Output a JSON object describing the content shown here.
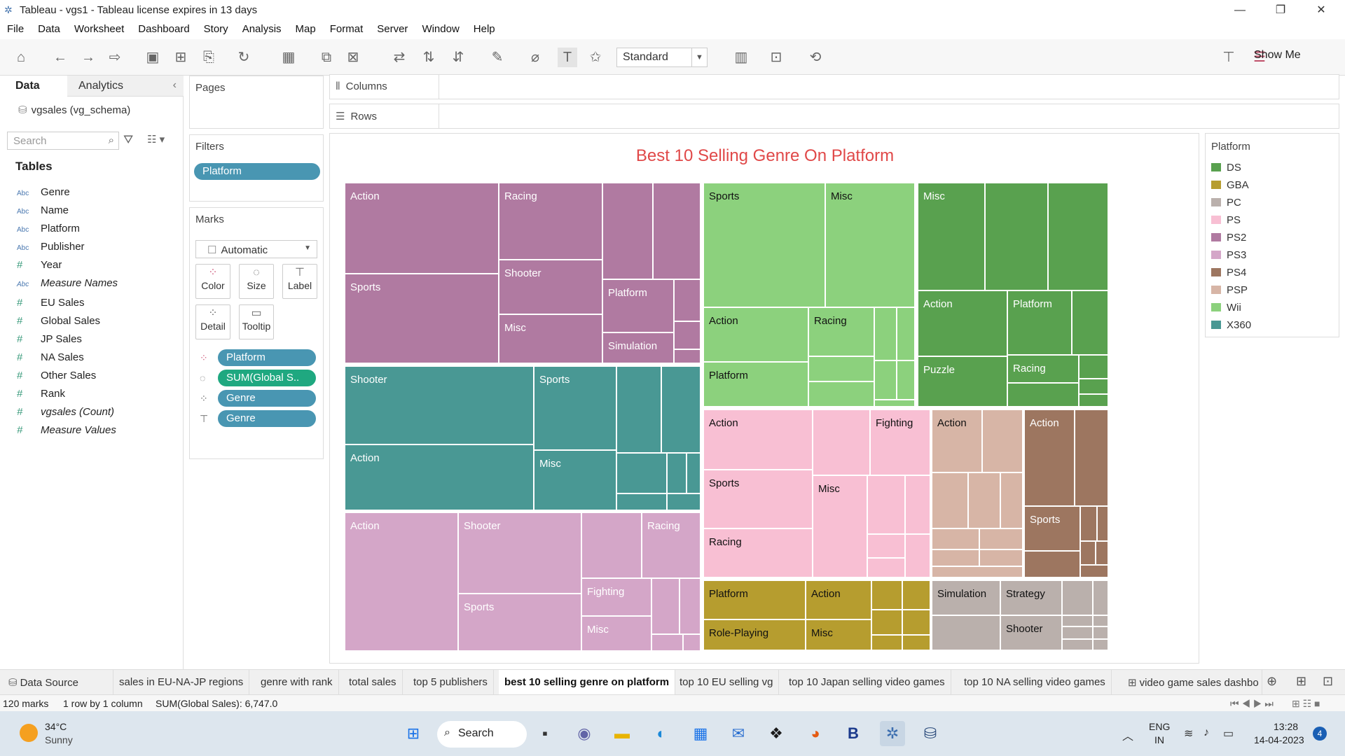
{
  "window": {
    "title": "Tableau - vgs1 - Tableau license expires in 13 days"
  },
  "menu": [
    "File",
    "Data",
    "Worksheet",
    "Dashboard",
    "Story",
    "Analysis",
    "Map",
    "Format",
    "Server",
    "Window",
    "Help"
  ],
  "toolbar": {
    "fit": "Standard",
    "show_me": "Show Me"
  },
  "data_pane": {
    "tab_data": "Data",
    "tab_analytics": "Analytics",
    "datasource": "vgsales (vg_schema)",
    "search_placeholder": "Search",
    "tables_heading": "Tables",
    "fields": [
      {
        "type": "Abc",
        "name": "Genre"
      },
      {
        "type": "Abc",
        "name": "Name"
      },
      {
        "type": "Abc",
        "name": "Platform"
      },
      {
        "type": "Abc",
        "name": "Publisher"
      },
      {
        "type": "#",
        "name": "Year"
      },
      {
        "type": "Abc",
        "name": "Measure Names"
      },
      {
        "type": "#",
        "name": "EU Sales"
      },
      {
        "type": "#",
        "name": "Global Sales"
      },
      {
        "type": "#",
        "name": "JP Sales"
      },
      {
        "type": "#",
        "name": "NA Sales"
      },
      {
        "type": "#",
        "name": "Other Sales"
      },
      {
        "type": "#",
        "name": "Rank"
      },
      {
        "type": "#",
        "name": "vgsales (Count)"
      },
      {
        "type": "#",
        "name": "Measure Values"
      }
    ]
  },
  "pages": {
    "label": "Pages"
  },
  "filters": {
    "label": "Filters",
    "pill": "Platform"
  },
  "marks": {
    "label": "Marks",
    "type": "Automatic",
    "buttons": [
      "Color",
      "Size",
      "Label",
      "Detail",
      "Tooltip"
    ],
    "pills": [
      "Platform",
      "SUM(Global S..",
      "Genre",
      "Genre"
    ]
  },
  "shelves": {
    "columns": "Columns",
    "rows": "Rows"
  },
  "viz": {
    "title": "Best 10 Selling Genre On Platform",
    "labels": {
      "ps2": [
        "Action",
        "Racing",
        "Sports",
        "Shooter",
        "Platform",
        "Misc",
        "Simulation"
      ],
      "x360": [
        "Shooter",
        "Sports",
        "Action",
        "Misc"
      ],
      "ps3": [
        "Action",
        "Shooter",
        "Racing",
        "Fighting",
        "Sports",
        "Misc"
      ],
      "wii": [
        "Sports",
        "Misc",
        "Action",
        "Racing",
        "Platform"
      ],
      "ds": [
        "Misc",
        "Action",
        "Platform",
        "Puzzle",
        "Racing"
      ],
      "ps": [
        "Action",
        "Fighting",
        "Sports",
        "Racing",
        "Misc"
      ],
      "psp": [
        "Action"
      ],
      "ps4": [
        "Action",
        "Sports"
      ],
      "gba": [
        "Platform",
        "Action",
        "Role-Playing",
        "Misc"
      ],
      "pc": [
        "Simulation",
        "Strategy",
        "Shooter"
      ]
    }
  },
  "legend": {
    "title": "Platform",
    "items": [
      {
        "name": "DS",
        "color": "#59a14f"
      },
      {
        "name": "GBA",
        "color": "#b69d2f"
      },
      {
        "name": "PC",
        "color": "#bab0ac"
      },
      {
        "name": "PS",
        "color": "#f8bfd3"
      },
      {
        "name": "PS2",
        "color": "#b07aa1"
      },
      {
        "name": "PS3",
        "color": "#d4a6c8"
      },
      {
        "name": "PS4",
        "color": "#9d7660"
      },
      {
        "name": "PSP",
        "color": "#d7b5a6"
      },
      {
        "name": "Wii",
        "color": "#8cd17d"
      },
      {
        "name": "X360",
        "color": "#499894"
      }
    ]
  },
  "sheet_tabs": [
    "Data Source",
    "sales in EU-NA-JP regions",
    "genre with rank",
    "total sales",
    "top 5 publishers",
    "best 10 selling genre on platform",
    "top 10 EU selling vg",
    "top 10 Japan selling video games",
    "top 10 NA selling video games",
    "video game sales dashbo"
  ],
  "status": {
    "marks": "120 marks",
    "rows": "1 row by 1 column",
    "sum": "SUM(Global Sales): 6,747.0"
  },
  "taskbar": {
    "temp": "34°C",
    "weather": "Sunny",
    "search": "Search",
    "lang1": "ENG",
    "lang2": "IN",
    "time": "13:28",
    "date": "14-04-2023",
    "badge": "4"
  }
}
